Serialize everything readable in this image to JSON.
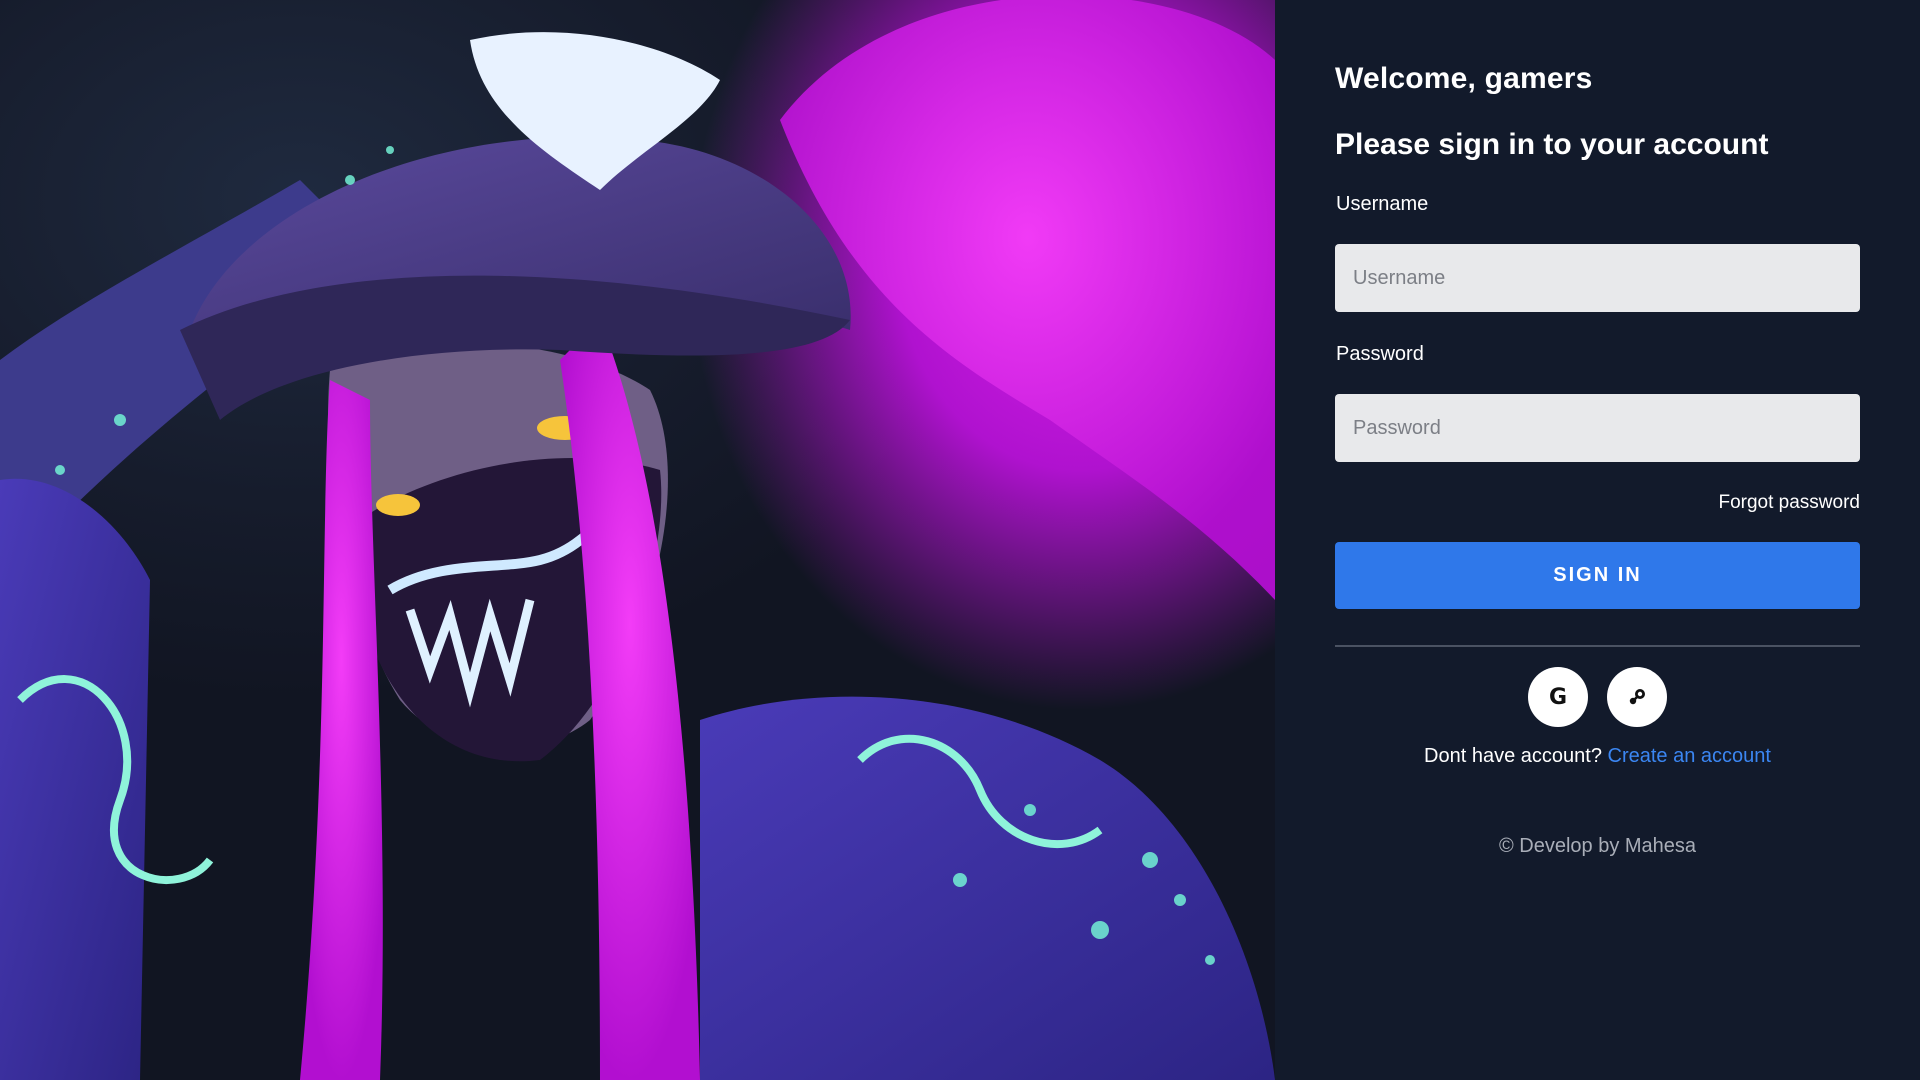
{
  "login": {
    "welcome": "Welcome, gamers",
    "subtitle": "Please sign in to your account",
    "username": {
      "label": "Username",
      "placeholder": "Username",
      "value": ""
    },
    "password": {
      "label": "Password",
      "placeholder": "Password",
      "value": ""
    },
    "forgot_password": "Forgot password",
    "sign_in_button": "SIGN IN",
    "social_buttons": [
      {
        "icon": "google-icon",
        "glyph": "G"
      },
      {
        "icon": "steam-icon"
      }
    ],
    "no_account_text": "Dont have account?",
    "create_account_link": "Create an account",
    "footer": "© Develop by Mahesa"
  },
  "colors": {
    "panel_background": "#121a2b",
    "primary_button": "#2f78ea",
    "link": "#3b86f2",
    "input_background": "#e8e9eb",
    "art_accent": "#d61ee8"
  }
}
